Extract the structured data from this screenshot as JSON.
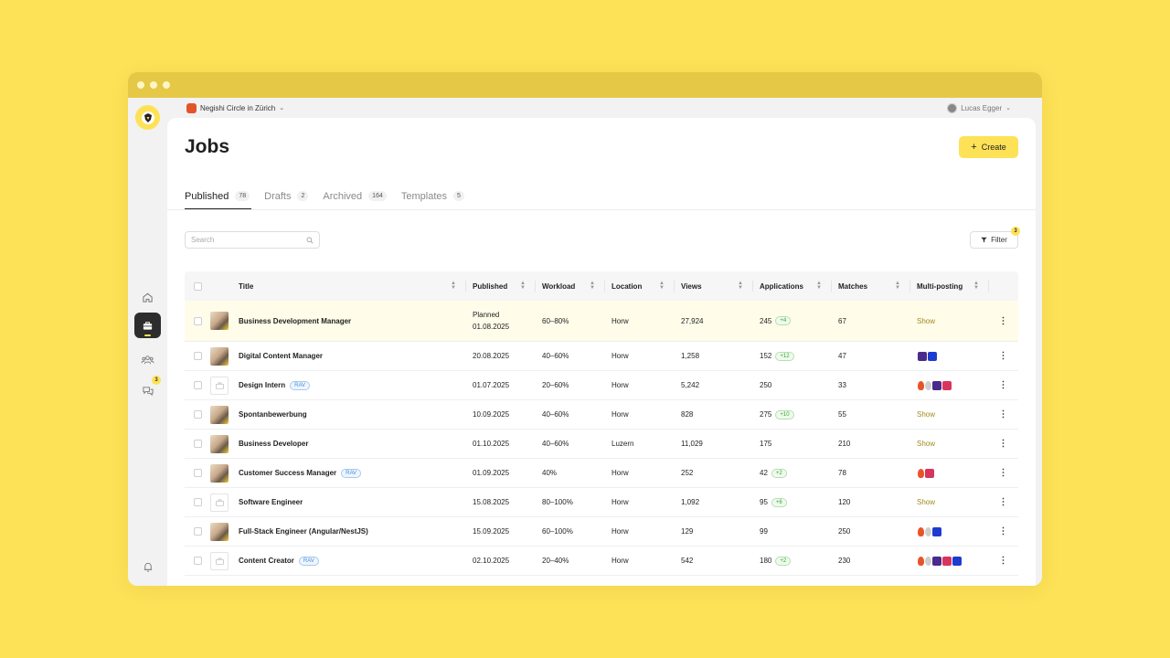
{
  "org": {
    "name": "Negishi Circle in Zürich"
  },
  "user": {
    "name": "Lucas Egger"
  },
  "sidebar": {
    "chat_badge": "3"
  },
  "page": {
    "title": "Jobs",
    "create_label": "Create"
  },
  "tabs": [
    {
      "label": "Published",
      "count": "78"
    },
    {
      "label": "Drafts",
      "count": "2"
    },
    {
      "label": "Archived",
      "count": "164"
    },
    {
      "label": "Templates",
      "count": "5"
    }
  ],
  "search": {
    "placeholder": "Search"
  },
  "filter": {
    "label": "Filter",
    "badge": "3"
  },
  "columns": {
    "title": "Title",
    "published": "Published",
    "workload": "Workload",
    "location": "Location",
    "views": "Views",
    "applications": "Applications",
    "matches": "Matches",
    "multiposting": "Multi-posting"
  },
  "rows": [
    {
      "title": "Business Development Manager",
      "published_status": "Planned",
      "published": "01.08.2025",
      "workload": "60–80%",
      "location": "Horw",
      "views": "27,924",
      "applications": "245",
      "app_badge": "+4",
      "matches": "67",
      "multiposting": "Show"
    },
    {
      "title": "Digital Content Manager",
      "published": "20.08.2025",
      "workload": "40–60%",
      "location": "Horw",
      "views": "1,258",
      "applications": "152",
      "app_badge": "+12",
      "matches": "47"
    },
    {
      "title": "Design Intern",
      "rav": "RAV",
      "published": "01.07.2025",
      "workload": "20–60%",
      "location": "Horw",
      "views": "5,242",
      "applications": "250",
      "matches": "33"
    },
    {
      "title": "Spontanbewerbung",
      "published": "10.09.2025",
      "workload": "40–60%",
      "location": "Horw",
      "views": "828",
      "applications": "275",
      "app_badge": "+10",
      "matches": "55",
      "multiposting": "Show"
    },
    {
      "title": "Business Developer",
      "published": "01.10.2025",
      "workload": "40–60%",
      "location": "Luzern",
      "views": "11,029",
      "applications": "175",
      "matches": "210",
      "multiposting": "Show"
    },
    {
      "title": "Customer Success Manager",
      "rav": "RAV",
      "published": "01.09.2025",
      "workload": "40%",
      "location": "Horw",
      "views": "252",
      "applications": "42",
      "app_badge": "+2",
      "matches": "78"
    },
    {
      "title": "Software Engineer",
      "published": "15.08.2025",
      "workload": "80–100%",
      "location": "Horw",
      "views": "1,092",
      "applications": "95",
      "app_badge": "+6",
      "matches": "120",
      "multiposting": "Show"
    },
    {
      "title": "Full-Stack Engineer (Angular/NestJS)",
      "published": "15.09.2025",
      "workload": "60–100%",
      "location": "Horw",
      "views": "129",
      "applications": "99",
      "matches": "250"
    },
    {
      "title": "Content Creator",
      "rav": "RAV",
      "published": "02.10.2025",
      "workload": "20–40%",
      "location": "Horw",
      "views": "542",
      "applications": "180",
      "app_badge": "+2",
      "matches": "230"
    }
  ],
  "colors": {
    "accent": "#fde257",
    "sidebar_active": "#2d2d2d"
  }
}
